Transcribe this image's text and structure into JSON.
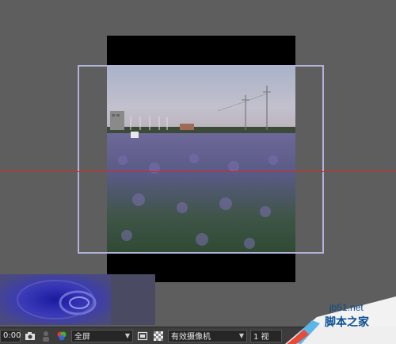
{
  "toolbar": {
    "timecode": "0:00",
    "resolution": "全屏",
    "camera": "有效摄像机",
    "views": "1 视"
  },
  "watermark": {
    "site": "jb51.net",
    "name": "脚本之家"
  },
  "colors": {
    "viewer_bg": "#5e5e5e",
    "guide_line": "#d42a2a",
    "layer_bounds": "#b3b3d9",
    "toolbar_bg": "#3c3c3c"
  },
  "icons": [
    "camera-icon",
    "person-icon",
    "rgb-channels-icon",
    "region-icon",
    "transparency-grid-icon"
  ]
}
